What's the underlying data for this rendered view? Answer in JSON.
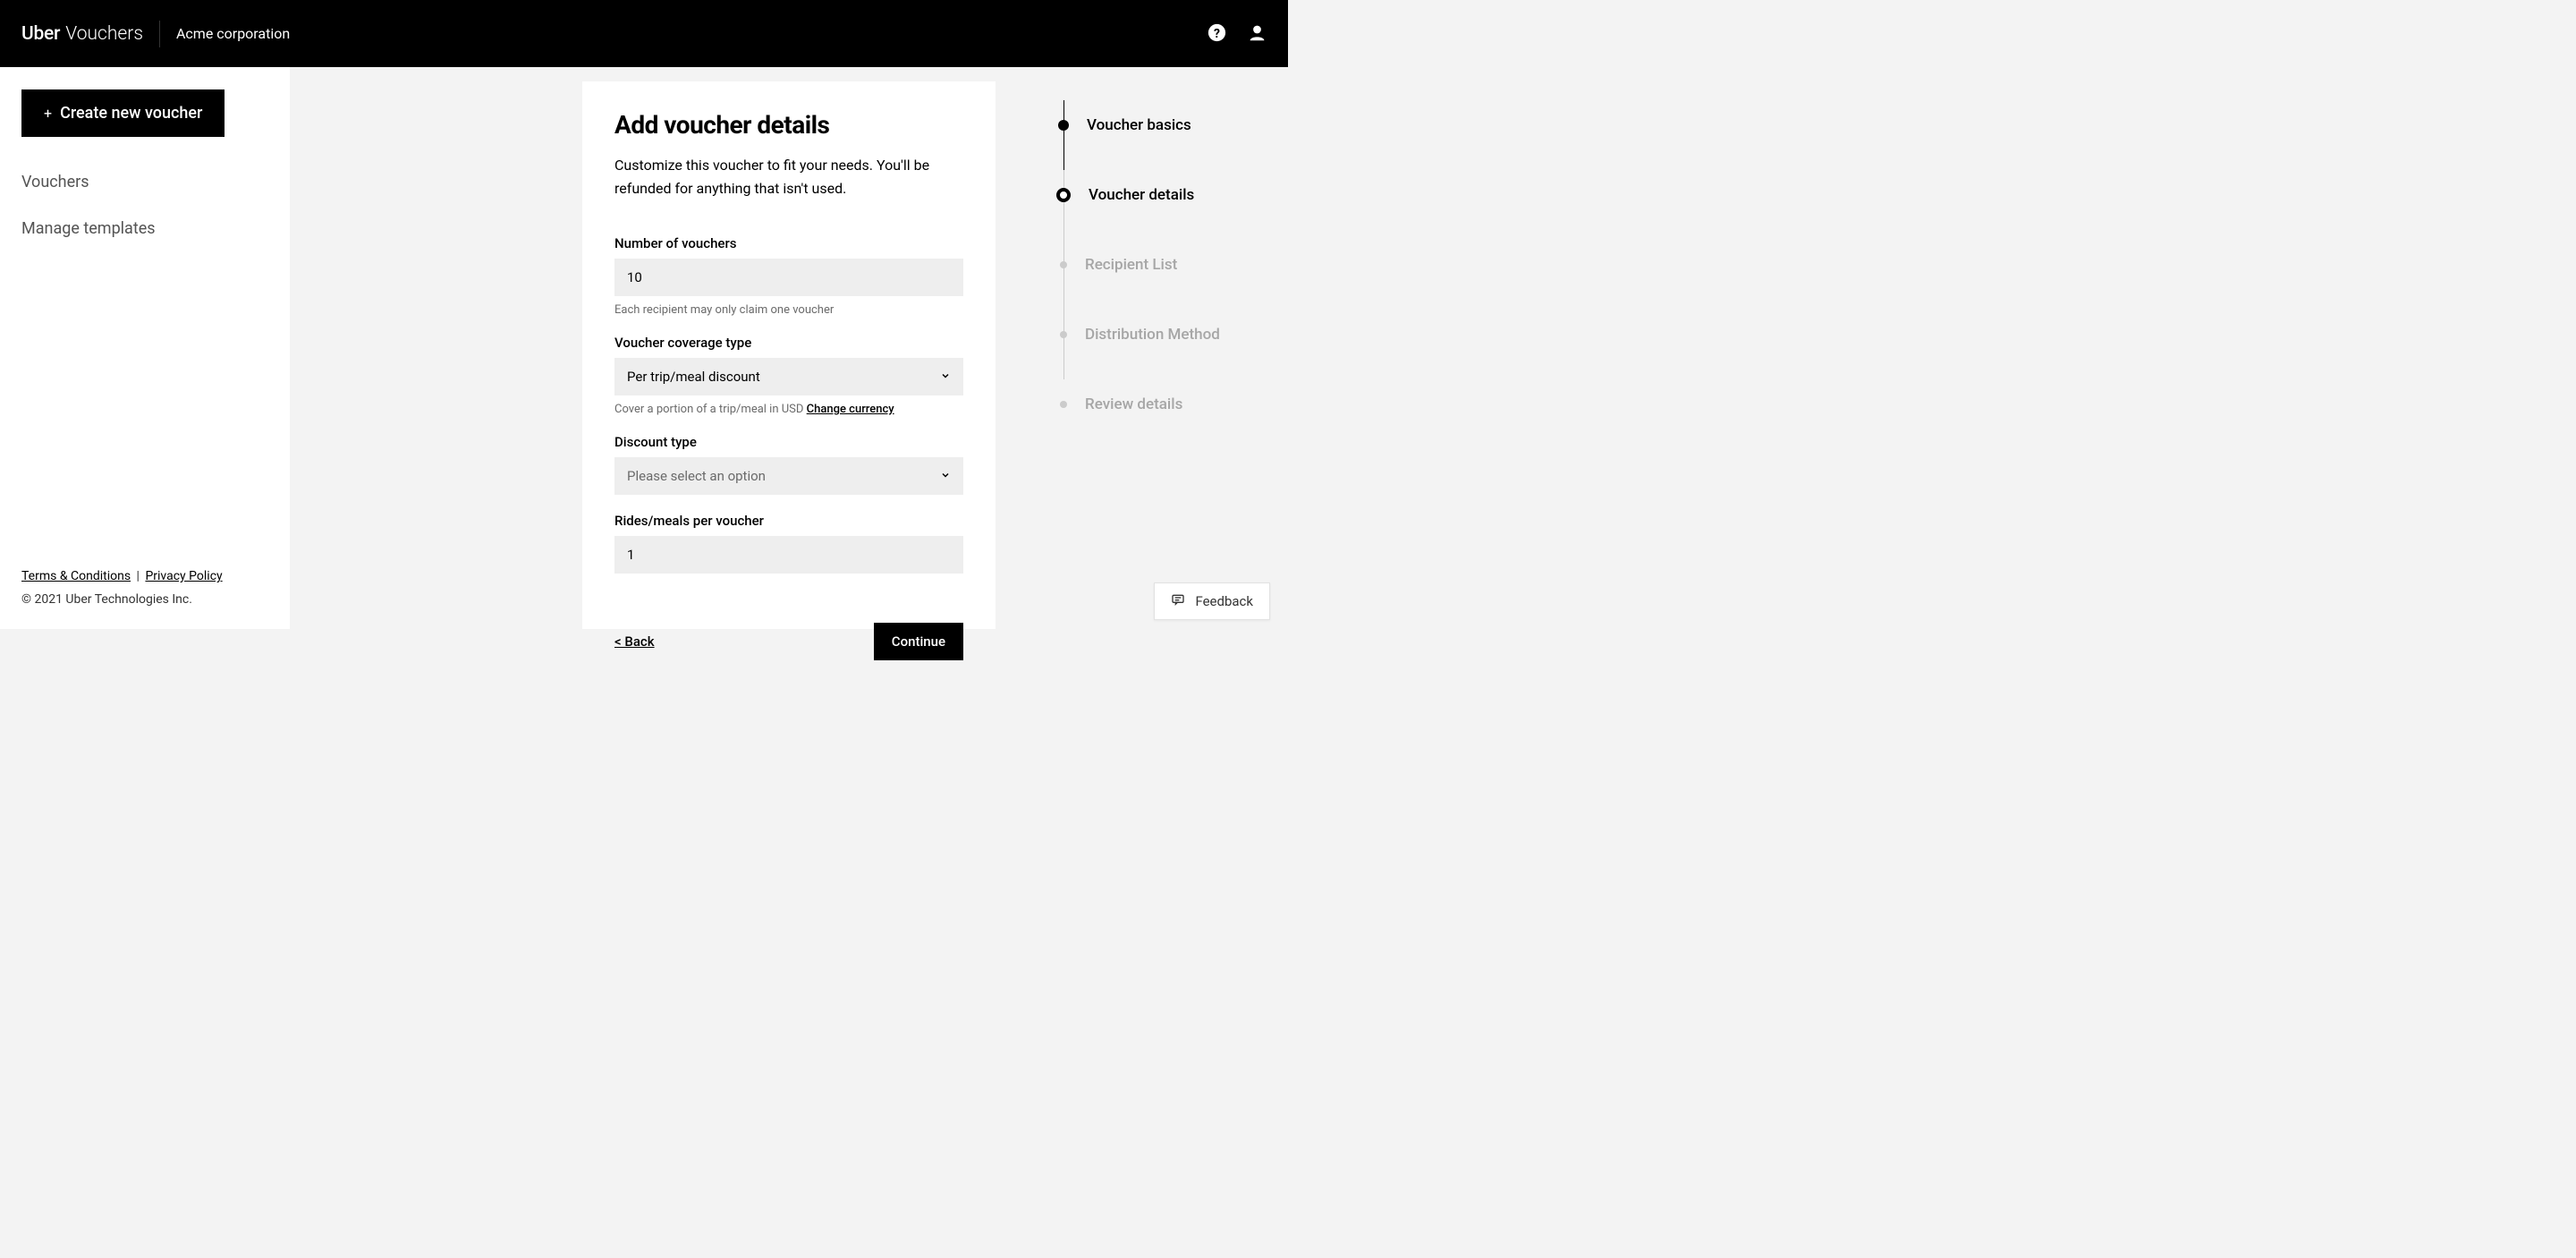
{
  "header": {
    "brand": "Uber",
    "product": "Vouchers",
    "org_name": "Acme corporation"
  },
  "sidebar": {
    "create_label": "Create new voucher",
    "items": [
      {
        "label": "Vouchers"
      },
      {
        "label": "Manage templates"
      }
    ],
    "footer": {
      "terms": "Terms & Conditions",
      "privacy": "Privacy Policy",
      "separator": "|",
      "copyright": "© 2021 Uber Technologies Inc."
    }
  },
  "form": {
    "title": "Add voucher details",
    "subtitle": "Customize this voucher to fit your needs. You'll be refunded for anything that isn't used.",
    "number_of_vouchers": {
      "label": "Number of vouchers",
      "value": "10",
      "hint": "Each recipient may only claim one voucher"
    },
    "coverage_type": {
      "label": "Voucher coverage type",
      "value": "Per trip/meal discount",
      "hint_prefix": "Cover a portion of a trip/meal in USD",
      "change_currency": "Change currency"
    },
    "discount_type": {
      "label": "Discount type",
      "placeholder": "Please select an option"
    },
    "rides_per_voucher": {
      "label": "Rides/meals per voucher",
      "value": "1"
    },
    "back_label": "< Back",
    "continue_label": "Continue"
  },
  "stepper": {
    "steps": [
      {
        "label": "Voucher basics",
        "state": "completed"
      },
      {
        "label": "Voucher details",
        "state": "current"
      },
      {
        "label": "Recipient List",
        "state": "upcoming"
      },
      {
        "label": "Distribution Method",
        "state": "upcoming"
      },
      {
        "label": "Review details",
        "state": "upcoming"
      }
    ]
  },
  "feedback": {
    "label": "Feedback"
  }
}
